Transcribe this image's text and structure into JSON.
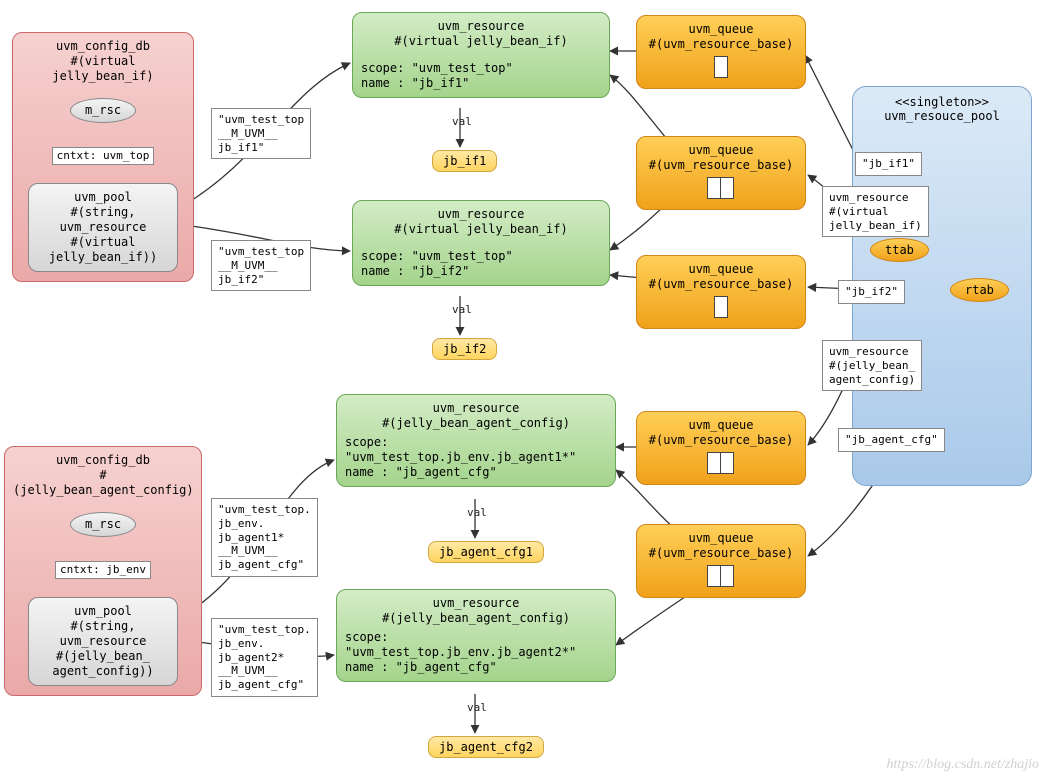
{
  "config_db_top": {
    "title_line1": "uvm_config_db",
    "title_line2": "#(virtual jelly_bean_if)",
    "m_rsc": "m_rsc",
    "cntxt": "cntxt: uvm_top",
    "pool_line1": "uvm_pool",
    "pool_line2": "#(string,",
    "pool_line3": "uvm_resource",
    "pool_line4": "#(virtual",
    "pool_line5": "jelly_bean_if))"
  },
  "config_db_bottom": {
    "title_line1": "uvm_config_db",
    "title_line2": "#(jelly_bean_agent_config)",
    "m_rsc": "m_rsc",
    "cntxt": "cntxt: jb_env",
    "pool_line1": "uvm_pool",
    "pool_line2": "#(string,",
    "pool_line3": "uvm_resource",
    "pool_line4": "#(jelly_bean_",
    "pool_line5": "agent_config))"
  },
  "edge_labels": {
    "pool1_res1": "\"uvm_test_top\n__M_UVM__\njb_if1\"",
    "pool1_res2": "\"uvm_test_top\n__M_UVM__\njb_if2\"",
    "pool2_res3": "\"uvm_test_top.\njb_env.\njb_agent1*\n__M_UVM__\njb_agent_cfg\"",
    "pool2_res4": "\"uvm_test_top.\njb_env.\njb_agent2*\n__M_UVM__\njb_agent_cfg\"",
    "ttab_if1": "\"jb_if1\"",
    "ttab_type_if": "uvm_resource\n#(virtual\njelly_bean_if)",
    "rtab_if2": "\"jb_if2\"",
    "ttab_type_cfg": "uvm_resource\n#(jelly_bean_\nagent_config)",
    "rtab_cfg": "\"jb_agent_cfg\""
  },
  "resources": {
    "r1_title1": "uvm_resource",
    "r1_title2": "#(virtual jelly_bean_if)",
    "r1_scope": "scope: \"uvm_test_top\"",
    "r1_name": "name : \"jb_if1\"",
    "r2_title1": "uvm_resource",
    "r2_title2": "#(virtual jelly_bean_if)",
    "r2_scope": "scope: \"uvm_test_top\"",
    "r2_name": "name : \"jb_if2\"",
    "r3_title1": "uvm_resource",
    "r3_title2": "#(jelly_bean_agent_config)",
    "r3_scope_label": "scope:",
    "r3_scope": "\"uvm_test_top.jb_env.jb_agent1*\"",
    "r3_name": "name : \"jb_agent_cfg\"",
    "r4_title1": "uvm_resource",
    "r4_title2": "#(jelly_bean_agent_config)",
    "r4_scope_label": "scope:",
    "r4_scope": "\"uvm_test_top.jb_env.jb_agent2*\"",
    "r4_name": "name : \"jb_agent_cfg\""
  },
  "val_labels": {
    "v1": "val",
    "v2": "val",
    "v3": "val",
    "v4": "val"
  },
  "val_tags": {
    "t1": "jb_if1",
    "t2": "jb_if2",
    "t3": "jb_agent_cfg1",
    "t4": "jb_agent_cfg2"
  },
  "queues": {
    "title1": "uvm_queue",
    "title2": "#(uvm_resource_base)"
  },
  "pool": {
    "singleton": "<<singleton>>",
    "name": "uvm_resouce_pool",
    "ttab": "ttab",
    "rtab": "rtab"
  },
  "watermark": "https://blog.csdn.net/zhajio"
}
